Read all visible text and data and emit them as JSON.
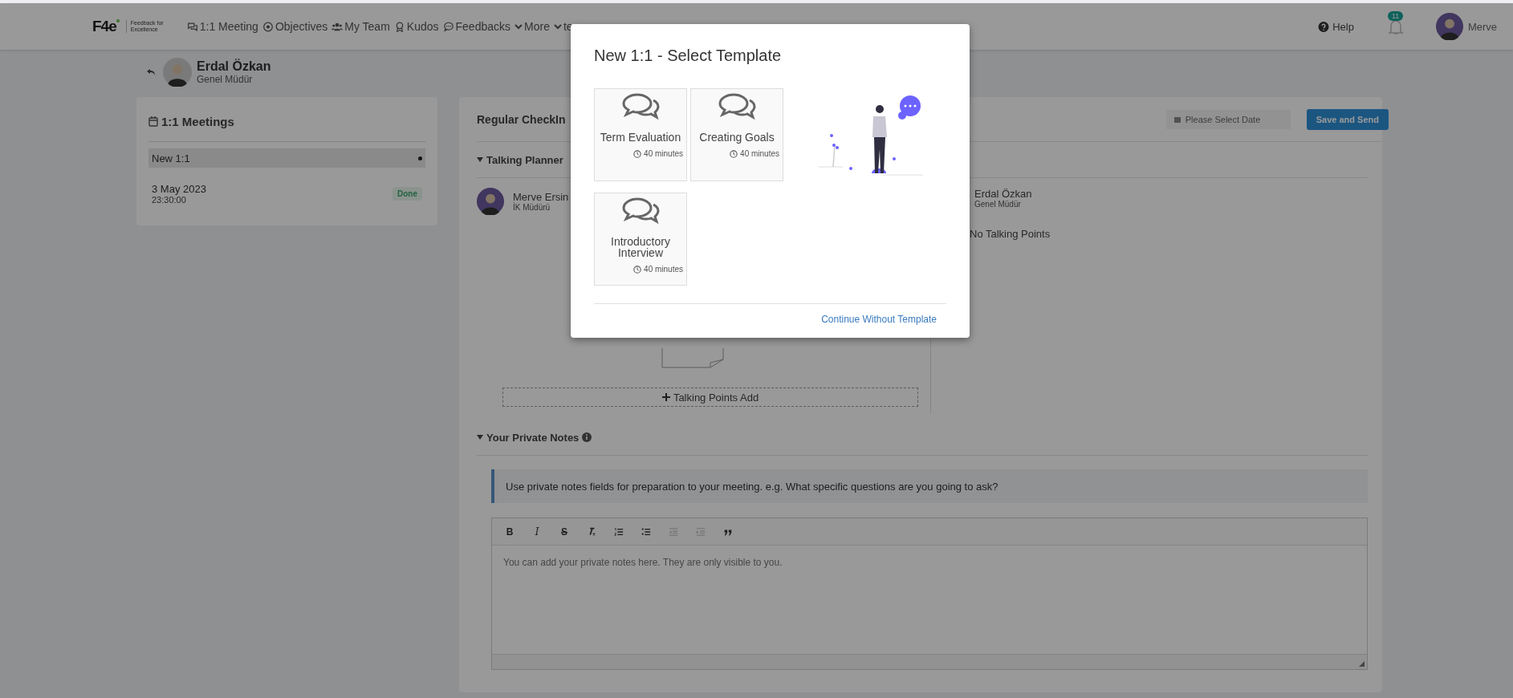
{
  "nav": {
    "logo": "F4e",
    "tagline": "Feedback for Excellence",
    "items": [
      {
        "kind": "chat",
        "label": "1:1 Meeting"
      },
      {
        "kind": "target",
        "label": "Objectives"
      },
      {
        "kind": "team",
        "label": "My Team"
      },
      {
        "kind": "award",
        "label": "Kudos"
      },
      {
        "kind": "comment",
        "label": "Feedbacks"
      },
      {
        "kind": "caret",
        "label": "More"
      },
      {
        "kind": "caret",
        "label": "te"
      }
    ],
    "help": "Help",
    "notifications": "11",
    "user": "Merve"
  },
  "person": {
    "name": "Erdal Özkan",
    "title": "Genel Müdür"
  },
  "meetings": {
    "title": "1:1 Meetings",
    "items": [
      {
        "title": "New 1:1",
        "selected": true
      },
      {
        "title": "3 May 2023",
        "time": "23:30:00",
        "status": "Done",
        "selected": false
      }
    ]
  },
  "checkin": {
    "title": "Regular CheckIn",
    "date_placeholder": "Please Select Date",
    "save": "Save and Send",
    "planner": {
      "title": "Talking Planner",
      "expanded": true,
      "participants": [
        {
          "name": "Merve Ersin",
          "title": "İK Müdürü"
        },
        {
          "name": "Erdal Özkan",
          "title": "Genel Müdür",
          "empty": "No Talking Points"
        }
      ],
      "add": "Talking Points Add"
    },
    "notes": {
      "title": "Your Private Notes",
      "expanded": true,
      "hint": "Use private notes fields for preparation to your meeting. e.g. What specific questions are you going to ask?",
      "toolbar": [
        {
          "kind": "bold",
          "label": "B",
          "disabled": false
        },
        {
          "kind": "italic",
          "label": "I",
          "disabled": false
        },
        {
          "kind": "strike",
          "label": "S",
          "disabled": false
        },
        {
          "kind": "clear",
          "disabled": false
        },
        {
          "kind": "ol",
          "disabled": false
        },
        {
          "kind": "ul",
          "disabled": false
        },
        {
          "kind": "outdent",
          "disabled": true
        },
        {
          "kind": "indent",
          "disabled": true
        },
        {
          "kind": "quote",
          "disabled": false
        }
      ],
      "value": "You can add your private notes here. They are only visible to you."
    }
  },
  "modal": {
    "title": "New 1:1 - Select Template",
    "templates": [
      {
        "name": "Term Evaluation",
        "duration": "40 minutes"
      },
      {
        "name": "Creating Goals",
        "duration": "40 minutes"
      },
      {
        "name": "Introductory Interview",
        "duration": "40 minutes"
      }
    ],
    "link": "Continue Without Template"
  }
}
